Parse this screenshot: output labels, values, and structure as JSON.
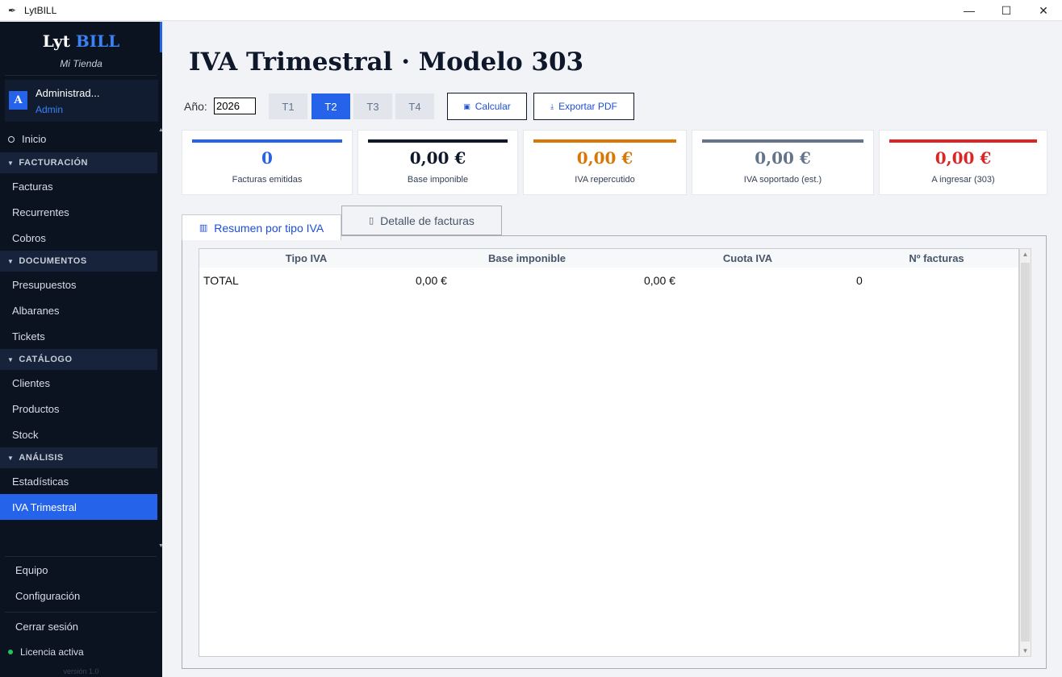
{
  "window": {
    "title": "LytBILL",
    "minimize": "—",
    "maximize": "☐",
    "close": "✕"
  },
  "sidebar": {
    "brand_a": "Lyt",
    "brand_b": "BILL",
    "store": "Mi Tienda",
    "user": {
      "initial": "A",
      "name": "Administrad...",
      "role": "Admin"
    },
    "home": "Inicio",
    "sections": [
      {
        "title": "FACTURACIÓN",
        "items": [
          "Facturas",
          "Recurrentes",
          "Cobros"
        ]
      },
      {
        "title": "DOCUMENTOS",
        "items": [
          "Presupuestos",
          "Albaranes",
          "Tickets"
        ]
      },
      {
        "title": "CATÁLOGO",
        "items": [
          "Clientes",
          "Productos",
          "Stock"
        ]
      },
      {
        "title": "ANÁLISIS",
        "items": [
          "Estadísticas",
          "IVA Trimestral"
        ]
      }
    ],
    "footer": {
      "team": "Equipo",
      "settings": "Configuración",
      "logout": "Cerrar sesión",
      "license": "Licencia activa",
      "version": "versión 1.0"
    }
  },
  "main": {
    "title": "IVA Trimestral · Modelo 303",
    "year_label": "Año:",
    "year_value": "2026",
    "quarters": [
      "T1",
      "T2",
      "T3",
      "T4"
    ],
    "active_quarter": "T2",
    "calc_button": "Calcular",
    "export_button": "Exportar PDF",
    "cards": [
      {
        "value": "0",
        "label": "Facturas emitidas",
        "color": "#2563eb"
      },
      {
        "value": "0,00 €",
        "label": "Base imponible",
        "color": "#0f172a"
      },
      {
        "value": "0,00 €",
        "label": "IVA repercutido",
        "color": "#d97706"
      },
      {
        "value": "0,00 €",
        "label": "IVA soportado (est.)",
        "color": "#64748b"
      },
      {
        "value": "0,00 €",
        "label": "A ingresar (303)",
        "color": "#dc2626"
      }
    ],
    "tabs": [
      "Resumen por tipo IVA",
      "Detalle de facturas"
    ],
    "table": {
      "headers": [
        "Tipo IVA",
        "Base imponible",
        "Cuota IVA",
        "Nº facturas"
      ],
      "rows": [
        [
          "TOTAL",
          "0,00 €",
          "0,00 €",
          "0"
        ]
      ]
    }
  }
}
